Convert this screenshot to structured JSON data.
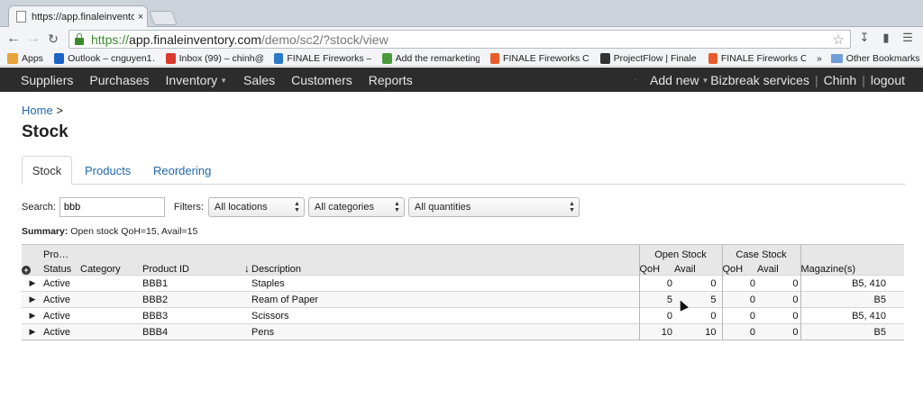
{
  "browser": {
    "tab_title": "https://app.finaleinventor",
    "tab_close": "×",
    "url_scheme": "https://",
    "url_host": "app.finaleinventory.com",
    "url_path": "/demo/sc2/?stock/view"
  },
  "bookmarks": [
    {
      "label": "Apps",
      "icon": "apps-grid-icon",
      "color": "#e8a33b"
    },
    {
      "label": "Outlook – cnguyen1…",
      "icon": "outlook-icon",
      "color": "#1d63c6"
    },
    {
      "label": "Inbox (99) – chinh@…",
      "icon": "gmail-icon",
      "color": "#d93a2b"
    },
    {
      "label": "FINALE Fireworks – …",
      "icon": "finale-icon",
      "color": "#2a79c9"
    },
    {
      "label": "Add the remarketing…",
      "icon": "google-icon",
      "color": "#4a9a3a"
    },
    {
      "label": "FINALE Fireworks CR…",
      "icon": "fireworks-icon",
      "color": "#e85b2a"
    },
    {
      "label": "ProjectFlow | Finale …",
      "icon": "projectflow-icon",
      "color": "#333333"
    },
    {
      "label": "FINALE Fireworks CR…",
      "icon": "fireworks-icon",
      "color": "#e85b2a"
    }
  ],
  "bookmarks_more": "»",
  "bookmarks_other": "Other Bookmarks",
  "nav": {
    "items": [
      "Suppliers",
      "Purchases",
      "Inventory",
      "Sales",
      "Customers",
      "Reports"
    ],
    "add_new": "Add new",
    "right_items": [
      "Bizbreak services",
      "Chinh",
      "logout"
    ]
  },
  "breadcrumb": {
    "home": "Home",
    "sep": ">"
  },
  "page_title": "Stock",
  "tabs": [
    "Stock",
    "Products",
    "Reordering"
  ],
  "search": {
    "label": "Search:",
    "value": "bbb"
  },
  "filters": {
    "label": "Filters:",
    "location": "All locations",
    "category": "All categories",
    "quantity": "All quantities"
  },
  "summary": {
    "label": "Summary:",
    "text": "Open stock QoH=15, Avail=15"
  },
  "table": {
    "group_headers": {
      "product": "Pro…",
      "open_stock": "Open Stock",
      "case_stock": "Case Stock"
    },
    "columns": {
      "status": "Status",
      "category": "Category",
      "product_id": "Product ID",
      "sort_indicator": "↓",
      "description": "Description",
      "open_qoh": "QoH",
      "open_avail": "Avail",
      "case_qoh": "QoH",
      "case_avail": "Avail",
      "magazines": "Magazine(s)"
    },
    "rows": [
      {
        "status": "Active",
        "category": "",
        "product_id": "BBB1",
        "description": "Staples",
        "open_qoh": "0",
        "open_avail": "0",
        "case_qoh": "0",
        "case_avail": "0",
        "magazines": "B5, 410"
      },
      {
        "status": "Active",
        "category": "",
        "product_id": "BBB2",
        "description": "Ream of Paper",
        "open_qoh": "5",
        "open_avail": "5",
        "case_qoh": "0",
        "case_avail": "0",
        "magazines": "B5"
      },
      {
        "status": "Active",
        "category": "",
        "product_id": "BBB3",
        "description": "Scissors",
        "open_qoh": "0",
        "open_avail": "0",
        "case_qoh": "0",
        "case_avail": "0",
        "magazines": "B5, 410"
      },
      {
        "status": "Active",
        "category": "",
        "product_id": "BBB4",
        "description": "Pens",
        "open_qoh": "10",
        "open_avail": "10",
        "case_qoh": "0",
        "case_avail": "0",
        "magazines": "B5"
      }
    ]
  },
  "colors": {
    "nav_bg": "#2c2c2c",
    "link": "#2166ad",
    "secure_green": "#3b8a2d"
  }
}
